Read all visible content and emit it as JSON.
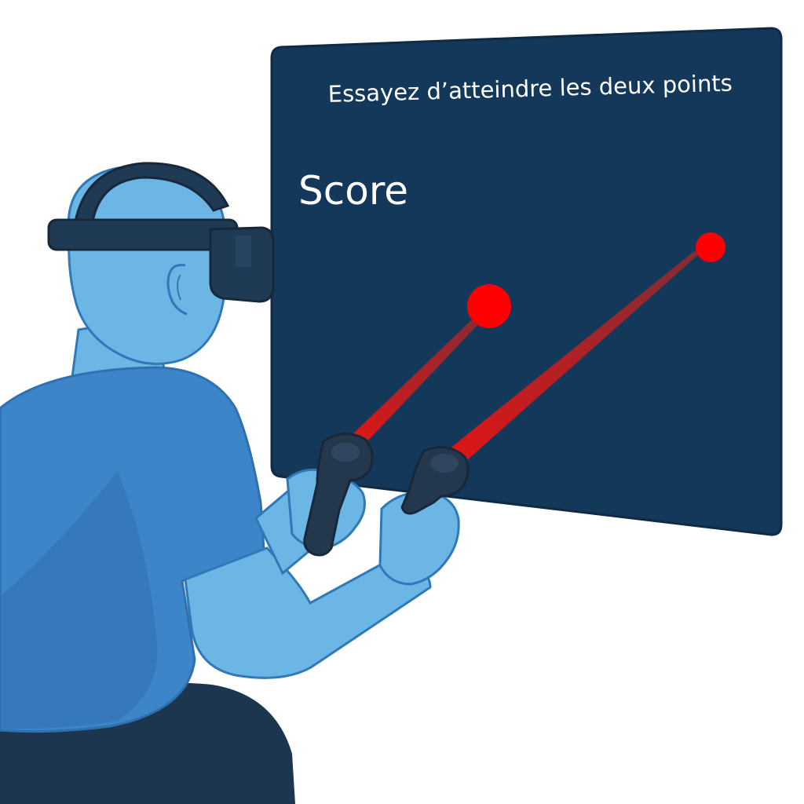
{
  "game": {
    "instruction": "Essayez d’atteindre les deux points",
    "score_label": "Score",
    "target_count": 2
  },
  "palette": {
    "panel_bg": "#13385a",
    "panel_border": "#0e2a44",
    "skin": "#6cb6e6",
    "skin_outline": "#2f79b8",
    "shirt": "#3c85c8",
    "shirt_shadow": "#2f70b0",
    "pants": "#1d3650",
    "headset": "#1f3a55",
    "controller": "#24384d",
    "target": "#ff0000",
    "laser": "#d61a1a"
  },
  "icons": {
    "player": "player-figure-icon",
    "headset": "vr-headset-icon",
    "controller": "vr-controller-icon",
    "target": "target-dot-icon"
  }
}
